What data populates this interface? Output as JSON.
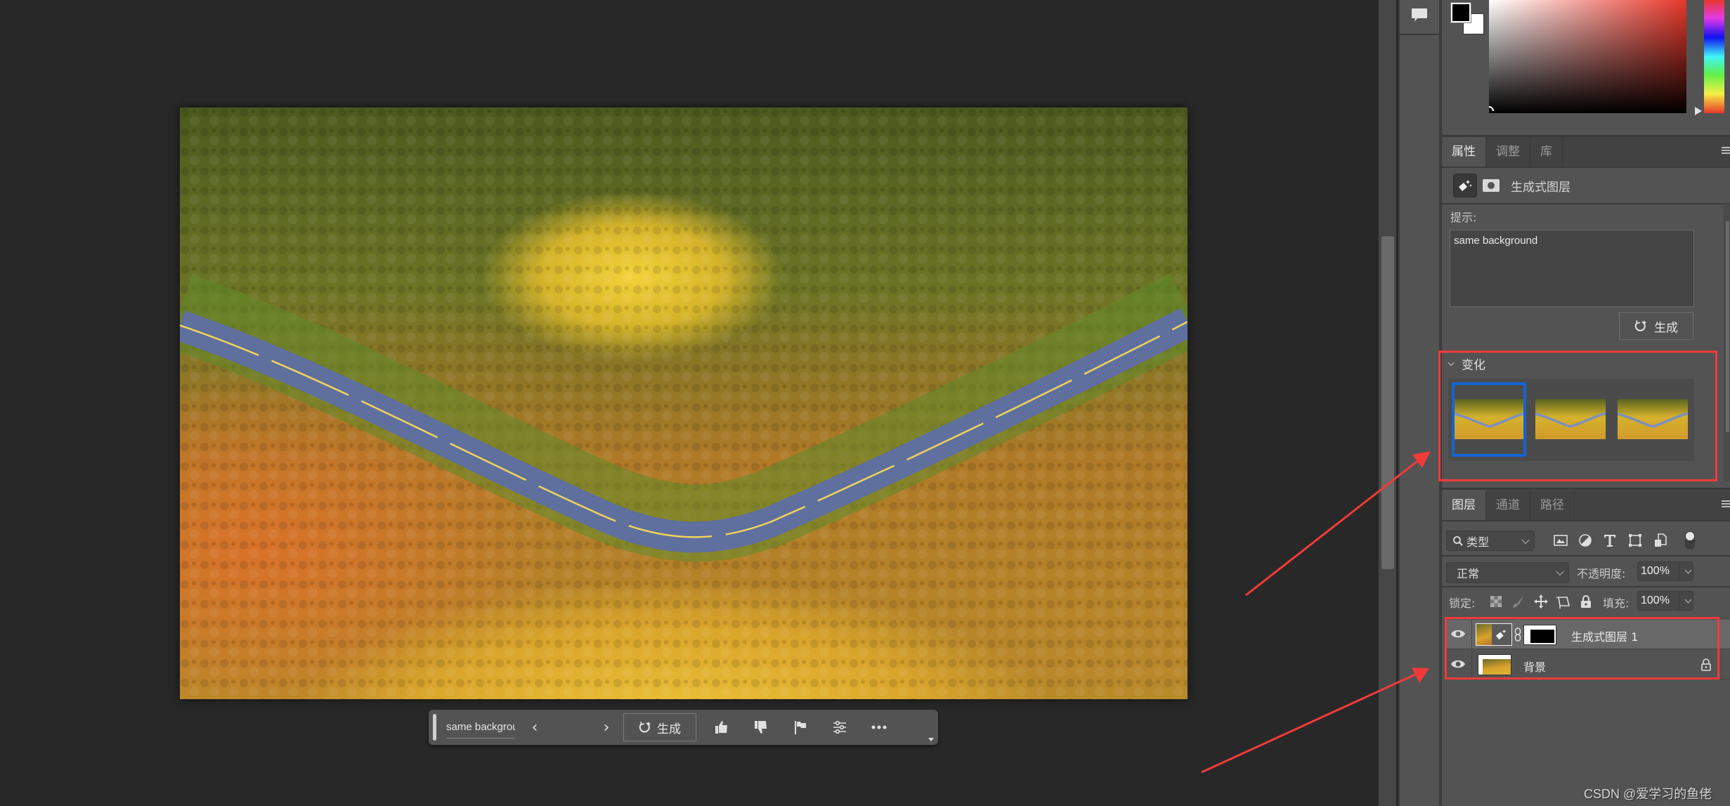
{
  "canvas": {
    "image_description": "Aerial view of a winding road through an autumn forest",
    "colors": {
      "forest_dark": "#3e4a1c",
      "forest_yellow": "#e7c52e",
      "forest_orange": "#d98a2a",
      "road": "#5f6f9e",
      "road_line": "#f0d45a"
    }
  },
  "contextual_taskbar": {
    "prompt_text": "same backgrou...",
    "prev_icon": "chevron-left-icon",
    "next_icon": "chevron-right-icon",
    "prev_glyph": "‹",
    "next_glyph": "›",
    "generate_label": "生成",
    "icons": [
      "thumbs-up-icon",
      "thumbs-down-icon",
      "flag-icon",
      "sliders-icon",
      "more-icon"
    ]
  },
  "color_panel": {
    "foreground_color": "#000000",
    "background_color": "#ffffff",
    "hue_color": "#e8372a"
  },
  "properties_panel": {
    "tabs": [
      {
        "label": "属性",
        "active": true
      },
      {
        "label": "调整",
        "active": false
      },
      {
        "label": "库",
        "active": false
      }
    ],
    "layer_type": "生成式图层",
    "prompt_label": "提示:",
    "prompt_value": "same background",
    "generate_label": "生成",
    "variations": {
      "title": "变化",
      "count": 3,
      "selected_index": 0
    }
  },
  "layers_panel": {
    "tabs": [
      {
        "label": "图层",
        "active": true
      },
      {
        "label": "通道",
        "active": false
      },
      {
        "label": "路径",
        "active": false
      }
    ],
    "filter_kind": "类型",
    "blend_mode": "正常",
    "opacity_label": "不透明度:",
    "opacity_value": "100%",
    "lock_label": "锁定:",
    "fill_label": "填充:",
    "fill_value": "100%",
    "layers": [
      {
        "name": "生成式图层 1",
        "visible": true,
        "selected": true,
        "locked": false
      },
      {
        "name": "背景",
        "visible": true,
        "selected": false,
        "locked": true
      }
    ]
  },
  "annotations": {
    "color": "#f23a3a",
    "selection_color": "#1463d3"
  },
  "watermark": "CSDN @爱学习的鱼佬"
}
